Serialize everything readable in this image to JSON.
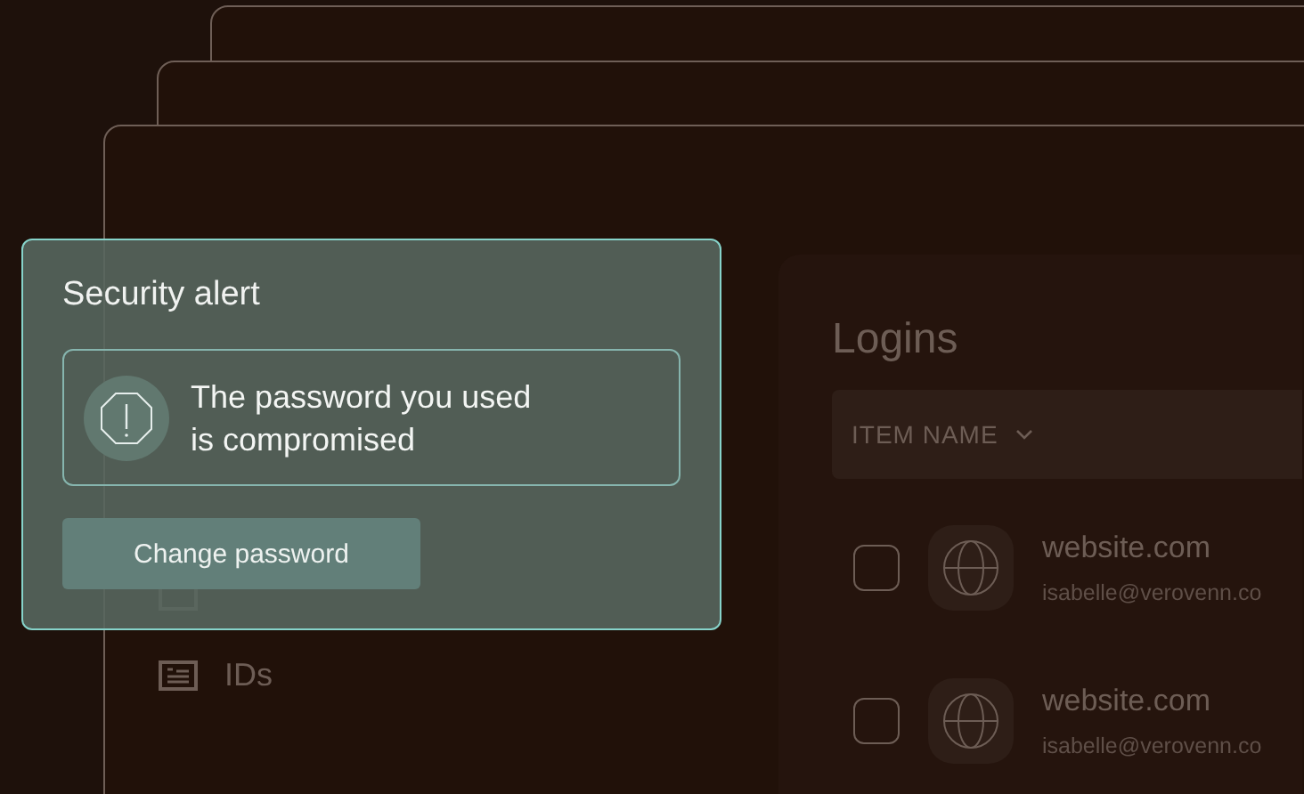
{
  "sidebar": {
    "items": [
      {
        "label": "IDs",
        "kind": "id"
      }
    ]
  },
  "logins": {
    "title": "Logins",
    "column": "ITEM NAME",
    "rows": [
      {
        "site": "website.com",
        "email": "isabelle@verovenn.co",
        "checked": false
      },
      {
        "site": "website.com",
        "email": "isabelle@verovenn.co",
        "checked": false
      }
    ]
  },
  "alert": {
    "title": "Security alert",
    "message": "The password you used is compromised",
    "button": "Change password"
  }
}
